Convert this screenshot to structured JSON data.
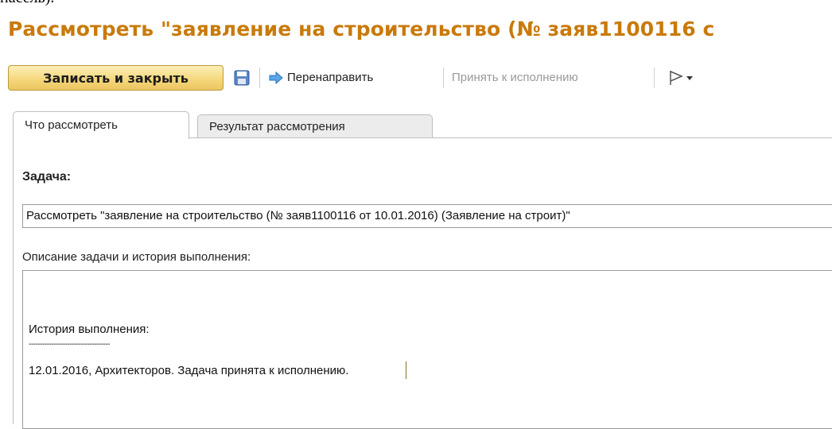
{
  "clipped_line": "насель).",
  "window": {
    "title": "Рассмотреть \"заявление на строительство (№ заяв1100116 с"
  },
  "toolbar": {
    "save_close_label": "Записать и закрыть",
    "redirect_label": "Перенаправить",
    "accept_label": "Принять к исполнению",
    "icons": [
      "save-icon",
      "redirect-arrow-icon",
      "flag-icon",
      "chevron-down-icon"
    ]
  },
  "tabs": [
    {
      "label": "Что рассмотреть",
      "active": true
    },
    {
      "label": "Результат рассмотрения",
      "active": false
    }
  ],
  "form": {
    "task_label": "Задача:",
    "task_value": "Рассмотреть \"заявление на строительство (№ заяв1100116 от 10.01.2016) (Заявление на строит)\"",
    "description_label": "Описание задачи и история выполнения:",
    "history_heading": "История выполнения:",
    "history_separator": "------------------------------------",
    "history_entry": "12.01.2016, Архитекторов. Задача принята к исполнению."
  },
  "colors": {
    "title": "#c97a0b",
    "primary_button": "#f4d67a",
    "disabled_text": "#9a9a9a",
    "redirect_icon": "#3b8de0"
  }
}
